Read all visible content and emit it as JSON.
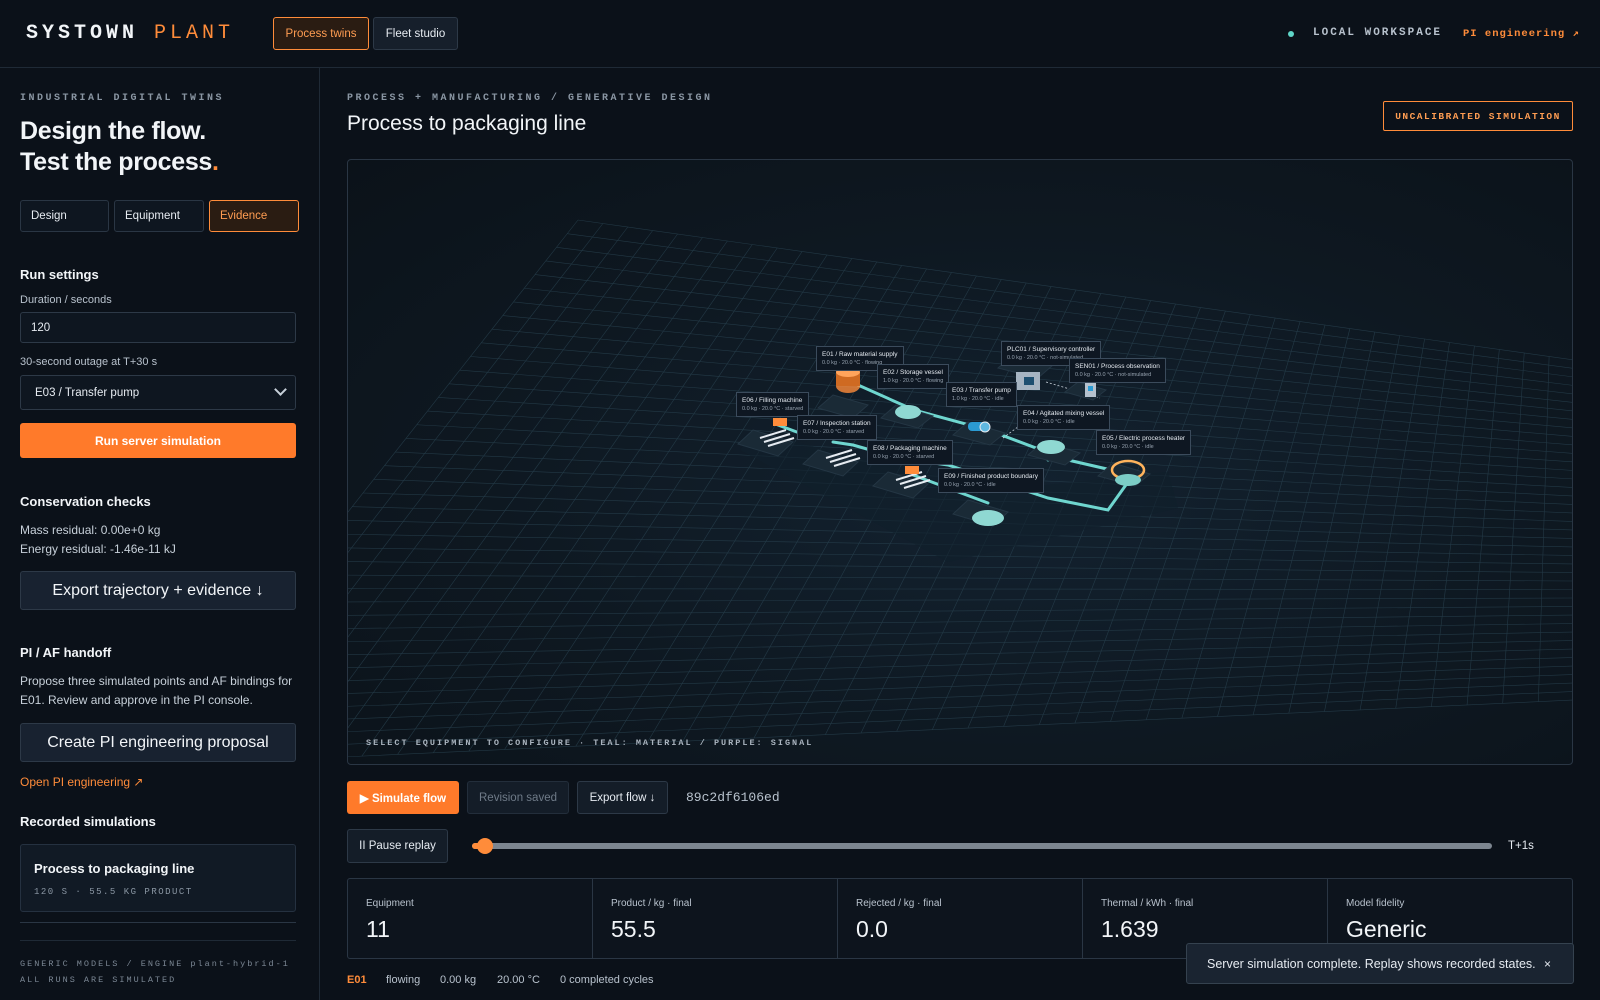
{
  "header": {
    "brand": "SYSTOWN",
    "brand_accent": "PLANT",
    "tabs": [
      "Process twins",
      "Fleet studio"
    ],
    "workspace": "LOCAL WORKSPACE",
    "pi_link": "PI engineering ↗",
    "status_dot_color": "#5fd6c8"
  },
  "sidebar": {
    "eyebrow": "INDUSTRIAL DIGITAL TWINS",
    "hero_line1": "Design the flow.",
    "hero_line2": "Test the process",
    "hero_period": ".",
    "segments": [
      "Design",
      "Equipment",
      "Evidence"
    ],
    "active_segment": "Evidence",
    "run_settings": {
      "title": "Run settings",
      "duration_label": "Duration / seconds",
      "duration_value": "120",
      "outage_label": "30-second outage at T+30 s",
      "outage_value": "E03 / Transfer pump",
      "run_button": "Run server simulation"
    },
    "conservation": {
      "title": "Conservation checks",
      "mass": "Mass residual: 0.00e+0 kg",
      "energy": "Energy residual: -1.46e-11 kJ",
      "export_button": "Export trajectory + evidence ↓"
    },
    "pi_af": {
      "title": "PI / AF handoff",
      "description_line1": "Propose three simulated points and AF bindings for",
      "description_line2": "E01. Review and approve in the PI console.",
      "proposal_button": "Create PI engineering proposal",
      "open_link": "Open PI engineering ↗"
    },
    "recorded": {
      "title": "Recorded simulations",
      "items": [
        {
          "name": "Process to packaging line",
          "meta": "120 S · 55.5 KG PRODUCT"
        }
      ]
    },
    "footer_line1": "GENERIC MODELS / ENGINE plant-hybrid-1",
    "footer_line2": "ALL RUNS ARE SIMULATED"
  },
  "main": {
    "eyebrow": "PROCESS + MANUFACTURING / GENERATIVE DESIGN",
    "title": "Process to packaging line",
    "badge": "UNCALIBRATED SIMULATION",
    "viewport_caption": "SELECT EQUIPMENT TO CONFIGURE · TEAL: MATERIAL / PURPLE: SIGNAL",
    "colors": {
      "material": "#6fd6cf",
      "signal": "#8f7ad8",
      "accent": "#ff7a2a"
    },
    "equipment": [
      {
        "name": "E01 / Raw material supply",
        "status": "0.0 kg · 20.0 °C · flowing"
      },
      {
        "name": "E02 / Storage vessel",
        "status": "1.0 kg · 20.0 °C · flowing"
      },
      {
        "name": "E03 / Transfer pump",
        "status": "1.0 kg · 20.0 °C · idle"
      },
      {
        "name": "E04 / Agitated mixing vessel",
        "status": "0.0 kg · 20.0 °C · idle"
      },
      {
        "name": "E05 / Electric process heater",
        "status": "0.0 kg · 20.0 °C · idle"
      },
      {
        "name": "E06 / Filling machine",
        "status": "0.0 kg · 20.0 °C · starved"
      },
      {
        "name": "E07 / Inspection station",
        "status": "0.0 kg · 20.0 °C · starved"
      },
      {
        "name": "E08 / Packaging machine",
        "status": "0.0 kg · 20.0 °C · starved"
      },
      {
        "name": "E09 / Finished product boundary",
        "status": "0.0 kg · 20.0 °C · idle"
      },
      {
        "name": "PLC01 / Supervisory controller",
        "status": "0.0 kg · 20.0 °C · not-simulated"
      },
      {
        "name": "SEN01 / Process observation",
        "status": "0.0 kg · 20.0 °C · not-simulated"
      }
    ],
    "controls": {
      "simulate": "▶ Simulate flow",
      "revision": "Revision saved",
      "export": "Export flow ↓",
      "hash": "89c2df6106ed",
      "pause": "II Pause replay",
      "replay_progress": 0.013,
      "time_label": "T+1s"
    },
    "stats": [
      {
        "label": "Equipment",
        "value": "11"
      },
      {
        "label": "Product / kg · final",
        "value": "55.5"
      },
      {
        "label": "Rejected / kg · final",
        "value": "0.0"
      },
      {
        "label": "Thermal / kWh · final",
        "value": "1.639"
      },
      {
        "label": "Model fidelity",
        "value": "Generic"
      }
    ],
    "status_row": {
      "id": "E01",
      "state": "flowing",
      "mass": "0.00 kg",
      "temp": "20.00 °C",
      "cycles": "0 completed cycles"
    },
    "toast": {
      "message": "Server simulation complete. Replay shows recorded states.",
      "close": "×"
    }
  }
}
